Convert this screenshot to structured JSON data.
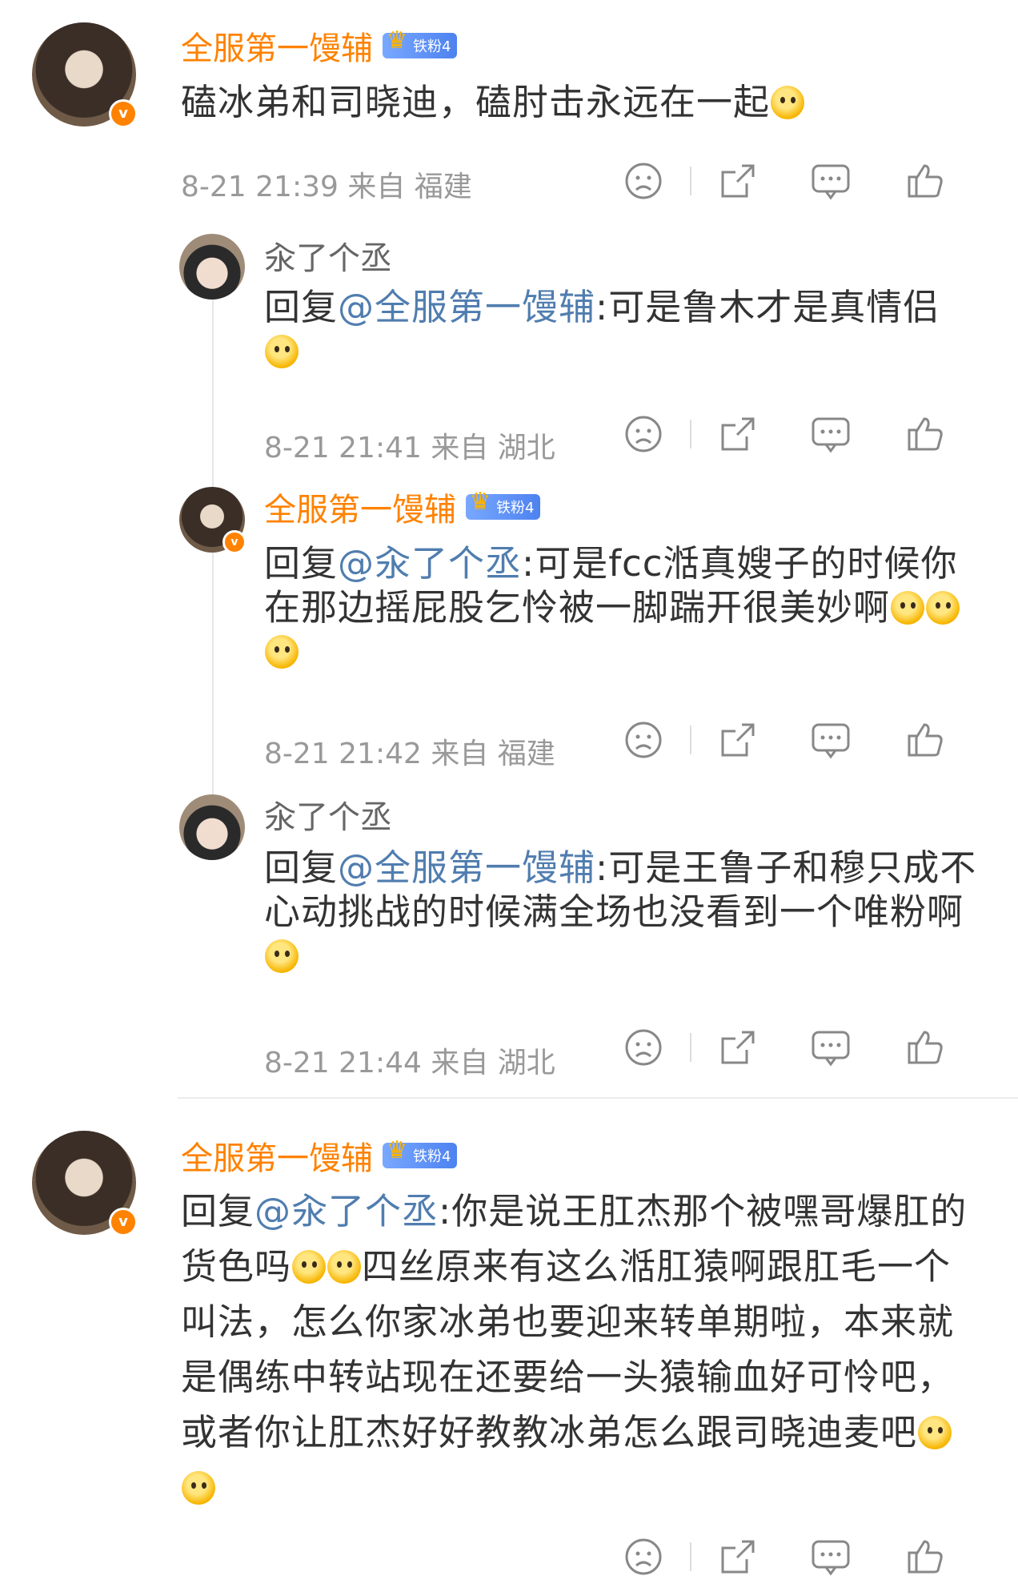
{
  "comments": [
    {
      "username": "全服第一馒辅",
      "fan_badge": "铁粉4",
      "verified": "v",
      "text": "磕冰弟和司晓迪，磕肘击永远在一起",
      "meta": "8-21 21:39  来自 福建"
    },
    {
      "username": "汆了个丞",
      "reply_prefix": "回复",
      "mention": "@全服第一馒辅",
      "text": ":可是鲁木才是真情侣",
      "meta": "8-21 21:41  来自 湖北"
    },
    {
      "username": "全服第一馒辅",
      "fan_badge": "铁粉4",
      "verified": "v",
      "reply_prefix": "回复",
      "mention": "@汆了个丞",
      "text": ":可是fcc湉真嫂子的时候你在那边摇屁股乞怜被一脚踹开很美妙啊",
      "meta": "8-21 21:42  来自 福建"
    },
    {
      "username": "汆了个丞",
      "reply_prefix": "回复",
      "mention": "@全服第一馒辅",
      "text": ":可是王鲁子和穆只成不心动挑战的时候满全场也没看到一个唯粉啊",
      "meta": "8-21 21:44  来自 湖北"
    },
    {
      "username": "全服第一馒辅",
      "fan_badge": "铁粉4",
      "verified": "v",
      "reply_prefix": "回复",
      "mention": "@汆了个丞",
      "text_a": ":你是说王肛杰那个被嘿哥爆肛的货色吗",
      "text_b": "四丝原来有这么湉肛猿啊跟肛毛一个叫法，怎么你家冰弟也要迎来转单期啦，本来就是偶练中转站现在还要给一头猿输血好可怜吧，或者你让肛杰好好教教冰弟怎么跟司晓迪麦吧"
    }
  ],
  "icons": {
    "dislike": "sad-face-icon",
    "share": "share-icon",
    "comment": "comment-icon",
    "like": "thumbs-up-icon"
  }
}
